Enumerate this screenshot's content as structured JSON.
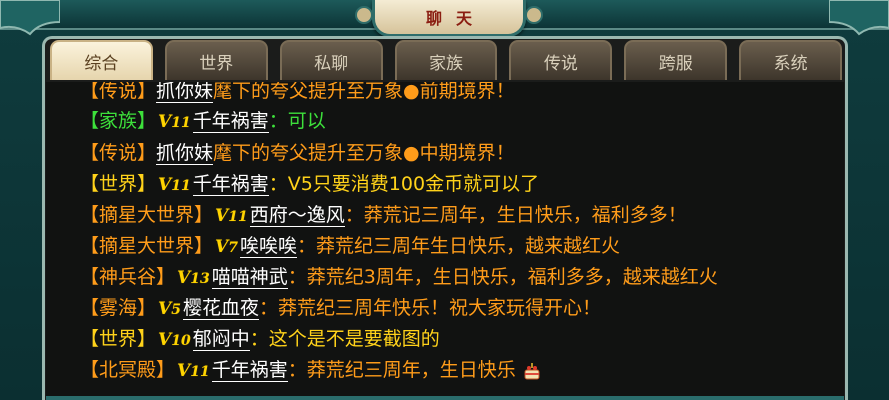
{
  "title": "聊天",
  "tabs": [
    {
      "label": "综合",
      "active": true
    },
    {
      "label": "世界",
      "active": false
    },
    {
      "label": "私聊",
      "active": false
    },
    {
      "label": "家族",
      "active": false
    },
    {
      "label": "传说",
      "active": false
    },
    {
      "label": "跨服",
      "active": false
    },
    {
      "label": "系统",
      "active": false
    }
  ],
  "messages": [
    {
      "channel": "【传说】",
      "channel_type": "legend",
      "vip": "",
      "name": "抓你妹",
      "text": "麾下的夸父提升至万象●前期境界！",
      "text_type": "orange",
      "partial": true
    },
    {
      "channel": "【家族】",
      "channel_type": "family",
      "vip": "11",
      "name": "千年祸害",
      "text": "：可以",
      "text_type": "family"
    },
    {
      "channel": "【传说】",
      "channel_type": "legend",
      "vip": "",
      "name": "抓你妹",
      "text": "麾下的夸父提升至万象●中期境界！",
      "text_type": "orange"
    },
    {
      "channel": "【世界】",
      "channel_type": "world",
      "vip": "11",
      "name": "千年祸害",
      "text": "：V5只要消费100金币就可以了",
      "text_type": "world"
    },
    {
      "channel": "【摘星大世界】",
      "channel_type": "server",
      "vip": "11",
      "name": "西府～逸风",
      "text": "：莽荒记三周年，生日快乐，福利多多！",
      "text_type": "orange"
    },
    {
      "channel": "【摘星大世界】",
      "channel_type": "server",
      "vip": "7",
      "name": "唉唉唉",
      "text": "：莽荒纪三周年生日快乐，越来越红火",
      "text_type": "orange"
    },
    {
      "channel": "【神兵谷】",
      "channel_type": "server",
      "vip": "13",
      "name": "喵喵神武",
      "text": "：莽荒纪3周年，生日快乐，福利多多，越来越红火",
      "text_type": "orange"
    },
    {
      "channel": "【雾海】",
      "channel_type": "server",
      "vip": "5",
      "name": "樱花血夜",
      "text": "：莽荒纪三周年快乐！祝大家玩得开心！",
      "text_type": "orange"
    },
    {
      "channel": "【世界】",
      "channel_type": "world",
      "vip": "10",
      "name": "郁闷中",
      "text": "：这个是不是要截图的",
      "text_type": "world"
    },
    {
      "channel": "【北冥殿】",
      "channel_type": "server",
      "vip": "11",
      "name": "千年祸害",
      "text": "：莽荒纪三周年，生日快乐",
      "text_type": "orange",
      "emoji": "cake-icon"
    }
  ],
  "colors": {
    "accent_gold": "#ffd400",
    "channel_orange": "#ff9c1a",
    "channel_green": "#3de03b",
    "channel_yellow": "#ffd21a",
    "name_white": "#ffffff"
  }
}
